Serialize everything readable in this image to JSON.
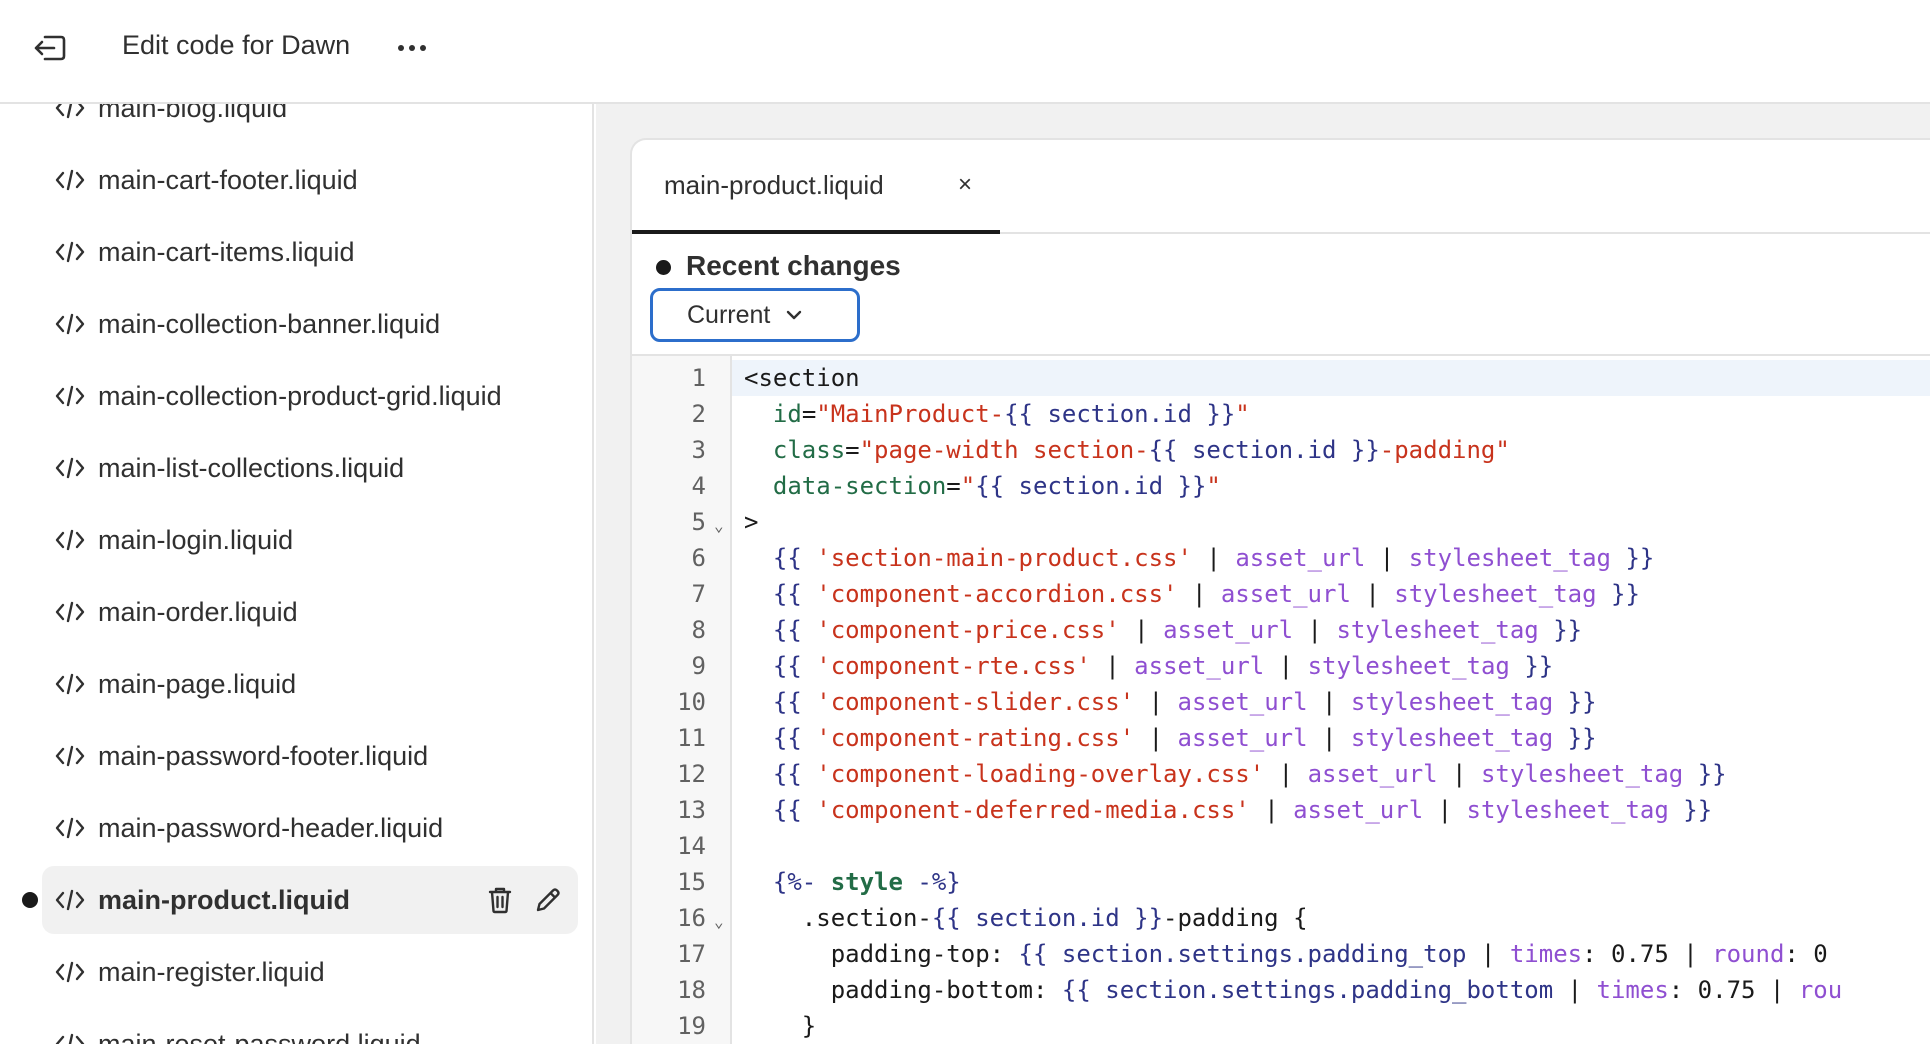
{
  "header": {
    "exit_icon": "exit-icon",
    "title": "Edit code for Dawn",
    "more_icon": "more-horizontal-icon"
  },
  "sidebar": {
    "file_icon": "code-file-icon",
    "items": [
      {
        "label": "main-blog.liquid"
      },
      {
        "label": "main-cart-footer.liquid"
      },
      {
        "label": "main-cart-items.liquid"
      },
      {
        "label": "main-collection-banner.liquid"
      },
      {
        "label": "main-collection-product-grid.liquid"
      },
      {
        "label": "main-list-collections.liquid"
      },
      {
        "label": "main-login.liquid"
      },
      {
        "label": "main-order.liquid"
      },
      {
        "label": "main-page.liquid"
      },
      {
        "label": "main-password-footer.liquid"
      },
      {
        "label": "main-password-header.liquid"
      },
      {
        "label": "main-product.liquid",
        "active": true,
        "modified": true
      },
      {
        "label": "main-register.liquid"
      },
      {
        "label": "main-reset-password.liquid"
      }
    ],
    "active_actions": [
      "delete-icon",
      "rename-icon"
    ]
  },
  "editor": {
    "tab_label": "main-product.liquid",
    "tab_close": "×",
    "recent_changes_title": "Recent changes",
    "version_select": "Current",
    "code_lines": [
      {
        "n": "1",
        "tokens": [
          [
            "plain",
            "<section"
          ]
        ]
      },
      {
        "n": "2",
        "tokens": [
          [
            "plain",
            "  "
          ],
          [
            "attr",
            "id"
          ],
          [
            "plain",
            "="
          ],
          [
            "str",
            "\"MainProduct-"
          ],
          [
            "var",
            "{{ section.id }}"
          ],
          [
            "str",
            "\""
          ]
        ]
      },
      {
        "n": "3",
        "tokens": [
          [
            "plain",
            "  "
          ],
          [
            "attr",
            "class"
          ],
          [
            "plain",
            "="
          ],
          [
            "str",
            "\"page-width section-"
          ],
          [
            "var",
            "{{ section.id }}"
          ],
          [
            "str",
            "-padding\""
          ]
        ]
      },
      {
        "n": "4",
        "tokens": [
          [
            "plain",
            "  "
          ],
          [
            "attr",
            "data-section"
          ],
          [
            "plain",
            "="
          ],
          [
            "str",
            "\""
          ],
          [
            "var",
            "{{ section.id }}"
          ],
          [
            "str",
            "\""
          ]
        ]
      },
      {
        "n": "5",
        "fold": true,
        "tokens": [
          [
            "plain",
            ">"
          ]
        ]
      },
      {
        "n": "6",
        "tokens": [
          [
            "plain",
            "  "
          ],
          [
            "var",
            "{{ "
          ],
          [
            "str",
            "'section-main-product.css'"
          ],
          [
            "plain",
            " | "
          ],
          [
            "filter",
            "asset_url"
          ],
          [
            "plain",
            " | "
          ],
          [
            "filter",
            "stylesheet_tag"
          ],
          [
            "var",
            " }}"
          ]
        ]
      },
      {
        "n": "7",
        "tokens": [
          [
            "plain",
            "  "
          ],
          [
            "var",
            "{{ "
          ],
          [
            "str",
            "'component-accordion.css'"
          ],
          [
            "plain",
            " | "
          ],
          [
            "filter",
            "asset_url"
          ],
          [
            "plain",
            " | "
          ],
          [
            "filter",
            "stylesheet_tag"
          ],
          [
            "var",
            " }}"
          ]
        ]
      },
      {
        "n": "8",
        "tokens": [
          [
            "plain",
            "  "
          ],
          [
            "var",
            "{{ "
          ],
          [
            "str",
            "'component-price.css'"
          ],
          [
            "plain",
            " | "
          ],
          [
            "filter",
            "asset_url"
          ],
          [
            "plain",
            " | "
          ],
          [
            "filter",
            "stylesheet_tag"
          ],
          [
            "var",
            " }}"
          ]
        ]
      },
      {
        "n": "9",
        "tokens": [
          [
            "plain",
            "  "
          ],
          [
            "var",
            "{{ "
          ],
          [
            "str",
            "'component-rte.css'"
          ],
          [
            "plain",
            " | "
          ],
          [
            "filter",
            "asset_url"
          ],
          [
            "plain",
            " | "
          ],
          [
            "filter",
            "stylesheet_tag"
          ],
          [
            "var",
            " }}"
          ]
        ]
      },
      {
        "n": "10",
        "tokens": [
          [
            "plain",
            "  "
          ],
          [
            "var",
            "{{ "
          ],
          [
            "str",
            "'component-slider.css'"
          ],
          [
            "plain",
            " | "
          ],
          [
            "filter",
            "asset_url"
          ],
          [
            "plain",
            " | "
          ],
          [
            "filter",
            "stylesheet_tag"
          ],
          [
            "var",
            " }}"
          ]
        ]
      },
      {
        "n": "11",
        "tokens": [
          [
            "plain",
            "  "
          ],
          [
            "var",
            "{{ "
          ],
          [
            "str",
            "'component-rating.css'"
          ],
          [
            "plain",
            " | "
          ],
          [
            "filter",
            "asset_url"
          ],
          [
            "plain",
            " | "
          ],
          [
            "filter",
            "stylesheet_tag"
          ],
          [
            "var",
            " }}"
          ]
        ]
      },
      {
        "n": "12",
        "tokens": [
          [
            "plain",
            "  "
          ],
          [
            "var",
            "{{ "
          ],
          [
            "str",
            "'component-loading-overlay.css'"
          ],
          [
            "plain",
            " | "
          ],
          [
            "filter",
            "asset_url"
          ],
          [
            "plain",
            " | "
          ],
          [
            "filter",
            "stylesheet_tag"
          ],
          [
            "var",
            " }}"
          ]
        ]
      },
      {
        "n": "13",
        "tokens": [
          [
            "plain",
            "  "
          ],
          [
            "var",
            "{{ "
          ],
          [
            "str",
            "'component-deferred-media.css'"
          ],
          [
            "plain",
            " | "
          ],
          [
            "filter",
            "asset_url"
          ],
          [
            "plain",
            " | "
          ],
          [
            "filter",
            "stylesheet_tag"
          ],
          [
            "var",
            " }}"
          ]
        ]
      },
      {
        "n": "14",
        "tokens": []
      },
      {
        "n": "15",
        "tokens": [
          [
            "plain",
            "  "
          ],
          [
            "var",
            "{%- "
          ],
          [
            "kw",
            "style"
          ],
          [
            "var",
            " -%}"
          ]
        ]
      },
      {
        "n": "16",
        "fold": true,
        "tokens": [
          [
            "plain",
            "    .section-"
          ],
          [
            "var",
            "{{ section.id }}"
          ],
          [
            "plain",
            "-padding {"
          ]
        ]
      },
      {
        "n": "17",
        "tokens": [
          [
            "plain",
            "      padding-top: "
          ],
          [
            "var",
            "{{ section.settings.padding_top"
          ],
          [
            "plain",
            " | "
          ],
          [
            "filter",
            "times"
          ],
          [
            "plain",
            ": 0.75 | "
          ],
          [
            "filter",
            "round"
          ],
          [
            "plain",
            ": 0"
          ]
        ]
      },
      {
        "n": "18",
        "tokens": [
          [
            "plain",
            "      padding-bottom: "
          ],
          [
            "var",
            "{{ section.settings.padding_bottom"
          ],
          [
            "plain",
            " | "
          ],
          [
            "filter",
            "times"
          ],
          [
            "plain",
            ": 0.75 | "
          ],
          [
            "filter",
            "rou"
          ]
        ]
      },
      {
        "n": "19",
        "tokens": [
          [
            "plain",
            "    }"
          ]
        ]
      }
    ]
  }
}
